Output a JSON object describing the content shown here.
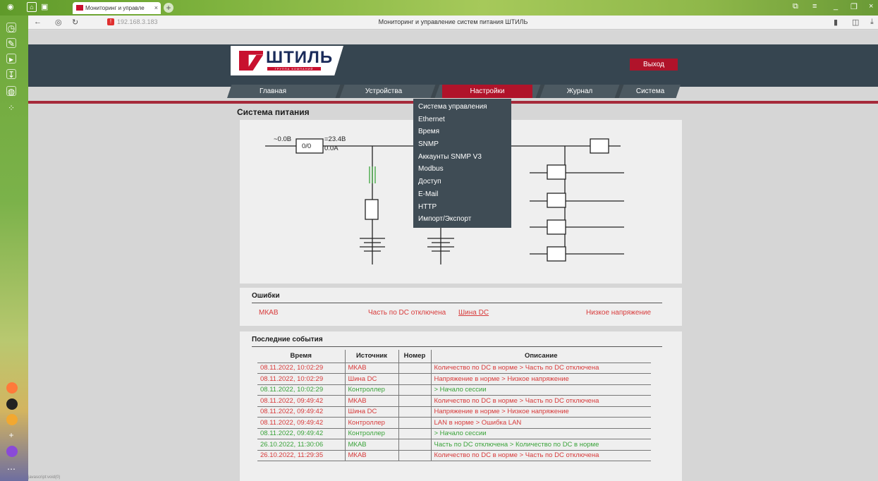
{
  "browser": {
    "tab_title": "Мониторинг и управле",
    "url": "192.168.3.183",
    "page_title": "Мониторинг и управление систем питания ШТИЛЬ",
    "status_text": "javascript:void(0)"
  },
  "header": {
    "logo_text": "ШТИЛЬ",
    "logo_sub": "ГРУППА КОМПАНИЙ",
    "exit_label": "Выход"
  },
  "menu": {
    "items": [
      {
        "label": "Главная"
      },
      {
        "label": "Устройства"
      },
      {
        "label": "Настройки"
      },
      {
        "label": "Журнал"
      },
      {
        "label": "Система"
      }
    ],
    "active_index": 2
  },
  "dropdown": {
    "items": [
      "Система управления",
      "Ethernet",
      "Время",
      "SNMP",
      "Аккаунты SNMP V3",
      "Modbus",
      "Доступ",
      "E-Mail",
      "HTTP",
      "Импорт/Экспорт"
    ]
  },
  "diagram": {
    "title": "Система питания",
    "input_voltage": "~0.0В",
    "converter_label": "0/0",
    "output_voltage": "=23.4В",
    "output_current": "0.0А"
  },
  "errors": {
    "title": "Ошибки",
    "source": "МКАВ",
    "message": "Часть по DC отключена",
    "source2": "Шина DC",
    "message2": "Низкое напряжение"
  },
  "events": {
    "title": "Последние события",
    "headers": [
      "Время",
      "Источник",
      "Номер",
      "Описание"
    ],
    "rows": [
      {
        "time": "08.11.2022, 10:02:29",
        "source": "МКАВ",
        "number": "",
        "desc": "Количество по DC в норме > Часть по DC отключена",
        "status": "red"
      },
      {
        "time": "08.11.2022, 10:02:29",
        "source": "Шина DC",
        "number": "",
        "desc": "Напряжение в норме > Низкое напряжение",
        "status": "red"
      },
      {
        "time": "08.11.2022, 10:02:29",
        "source": "Контроллер",
        "number": "",
        "desc": "> Начало сессии",
        "status": "green"
      },
      {
        "time": "08.11.2022, 09:49:42",
        "source": "МКАВ",
        "number": "",
        "desc": "Количество по DC в норме > Часть по DC отключена",
        "status": "red"
      },
      {
        "time": "08.11.2022, 09:49:42",
        "source": "Шина DC",
        "number": "",
        "desc": "Напряжение в норме > Низкое напряжение",
        "status": "red"
      },
      {
        "time": "08.11.2022, 09:49:42",
        "source": "Контроллер",
        "number": "",
        "desc": "LAN в норме > Ошибка LAN",
        "status": "red"
      },
      {
        "time": "08.11.2022, 09:49:42",
        "source": "Контроллер",
        "number": "",
        "desc": "> Начало сессии",
        "status": "green"
      },
      {
        "time": "26.10.2022, 11:30:06",
        "source": "МКАВ",
        "number": "",
        "desc": "Часть по DC отключена > Количество по DC в норме",
        "status": "green"
      },
      {
        "time": "26.10.2022, 11:29:35",
        "source": "МКАВ",
        "number": "",
        "desc": "Количество по DC в норме > Часть по DC отключена",
        "status": "red"
      }
    ]
  },
  "colors": {
    "header_bg": "#364550",
    "accent_red": "#b0132a",
    "error_text": "#d83a3a",
    "ok_text": "#3aa33a"
  }
}
